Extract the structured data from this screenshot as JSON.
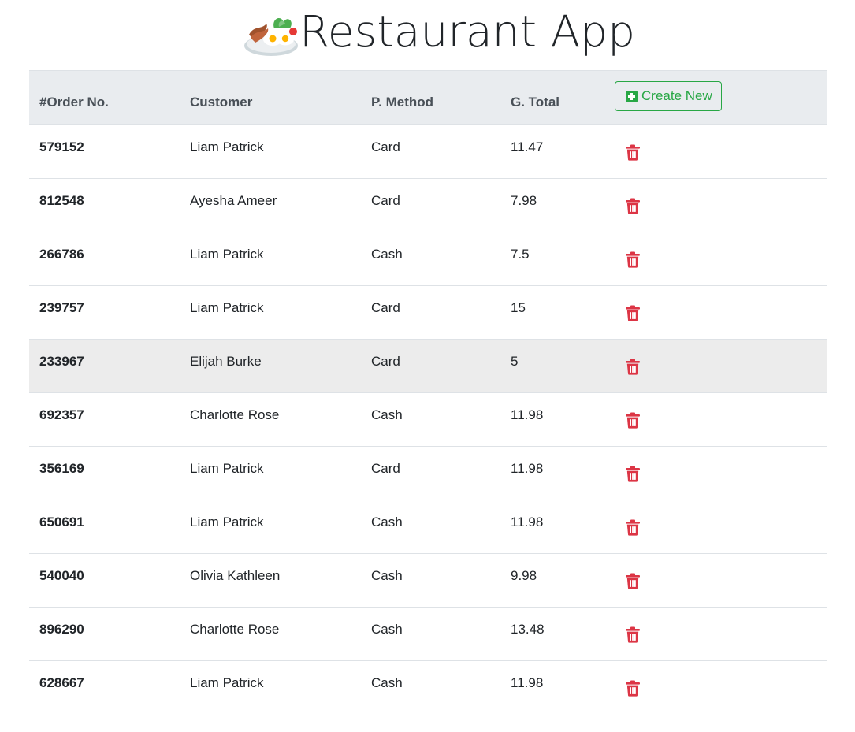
{
  "app": {
    "title": "Restaurant App",
    "logo_icon": "breakfast-plate-icon"
  },
  "table": {
    "headers": {
      "order_no": "#Order No.",
      "customer": "Customer",
      "payment_method": "P. Method",
      "grand_total": "G. Total"
    },
    "create_button": {
      "label": "Create New",
      "icon": "plus-square-icon",
      "color": "#28a745"
    },
    "delete_icon": "trash-icon",
    "delete_color": "#dc3545",
    "rows": [
      {
        "order_no": "579152",
        "customer": "Liam Patrick",
        "method": "Card",
        "total": "11.47"
      },
      {
        "order_no": "812548",
        "customer": "Ayesha Ameer",
        "method": "Card",
        "total": "7.98"
      },
      {
        "order_no": "266786",
        "customer": "Liam Patrick",
        "method": "Cash",
        "total": "7.5"
      },
      {
        "order_no": "239757",
        "customer": "Liam Patrick",
        "method": "Card",
        "total": "15"
      },
      {
        "order_no": "233967",
        "customer": "Elijah Burke",
        "method": "Card",
        "total": "5",
        "hovered": true
      },
      {
        "order_no": "692357",
        "customer": "Charlotte Rose",
        "method": "Cash",
        "total": "11.98"
      },
      {
        "order_no": "356169",
        "customer": "Liam Patrick",
        "method": "Card",
        "total": "11.98"
      },
      {
        "order_no": "650691",
        "customer": "Liam Patrick",
        "method": "Cash",
        "total": "11.98"
      },
      {
        "order_no": "540040",
        "customer": "Olivia Kathleen",
        "method": "Cash",
        "total": "9.98"
      },
      {
        "order_no": "896290",
        "customer": "Charlotte Rose",
        "method": "Cash",
        "total": "13.48"
      },
      {
        "order_no": "628667",
        "customer": "Liam Patrick",
        "method": "Cash",
        "total": "11.98"
      }
    ]
  }
}
